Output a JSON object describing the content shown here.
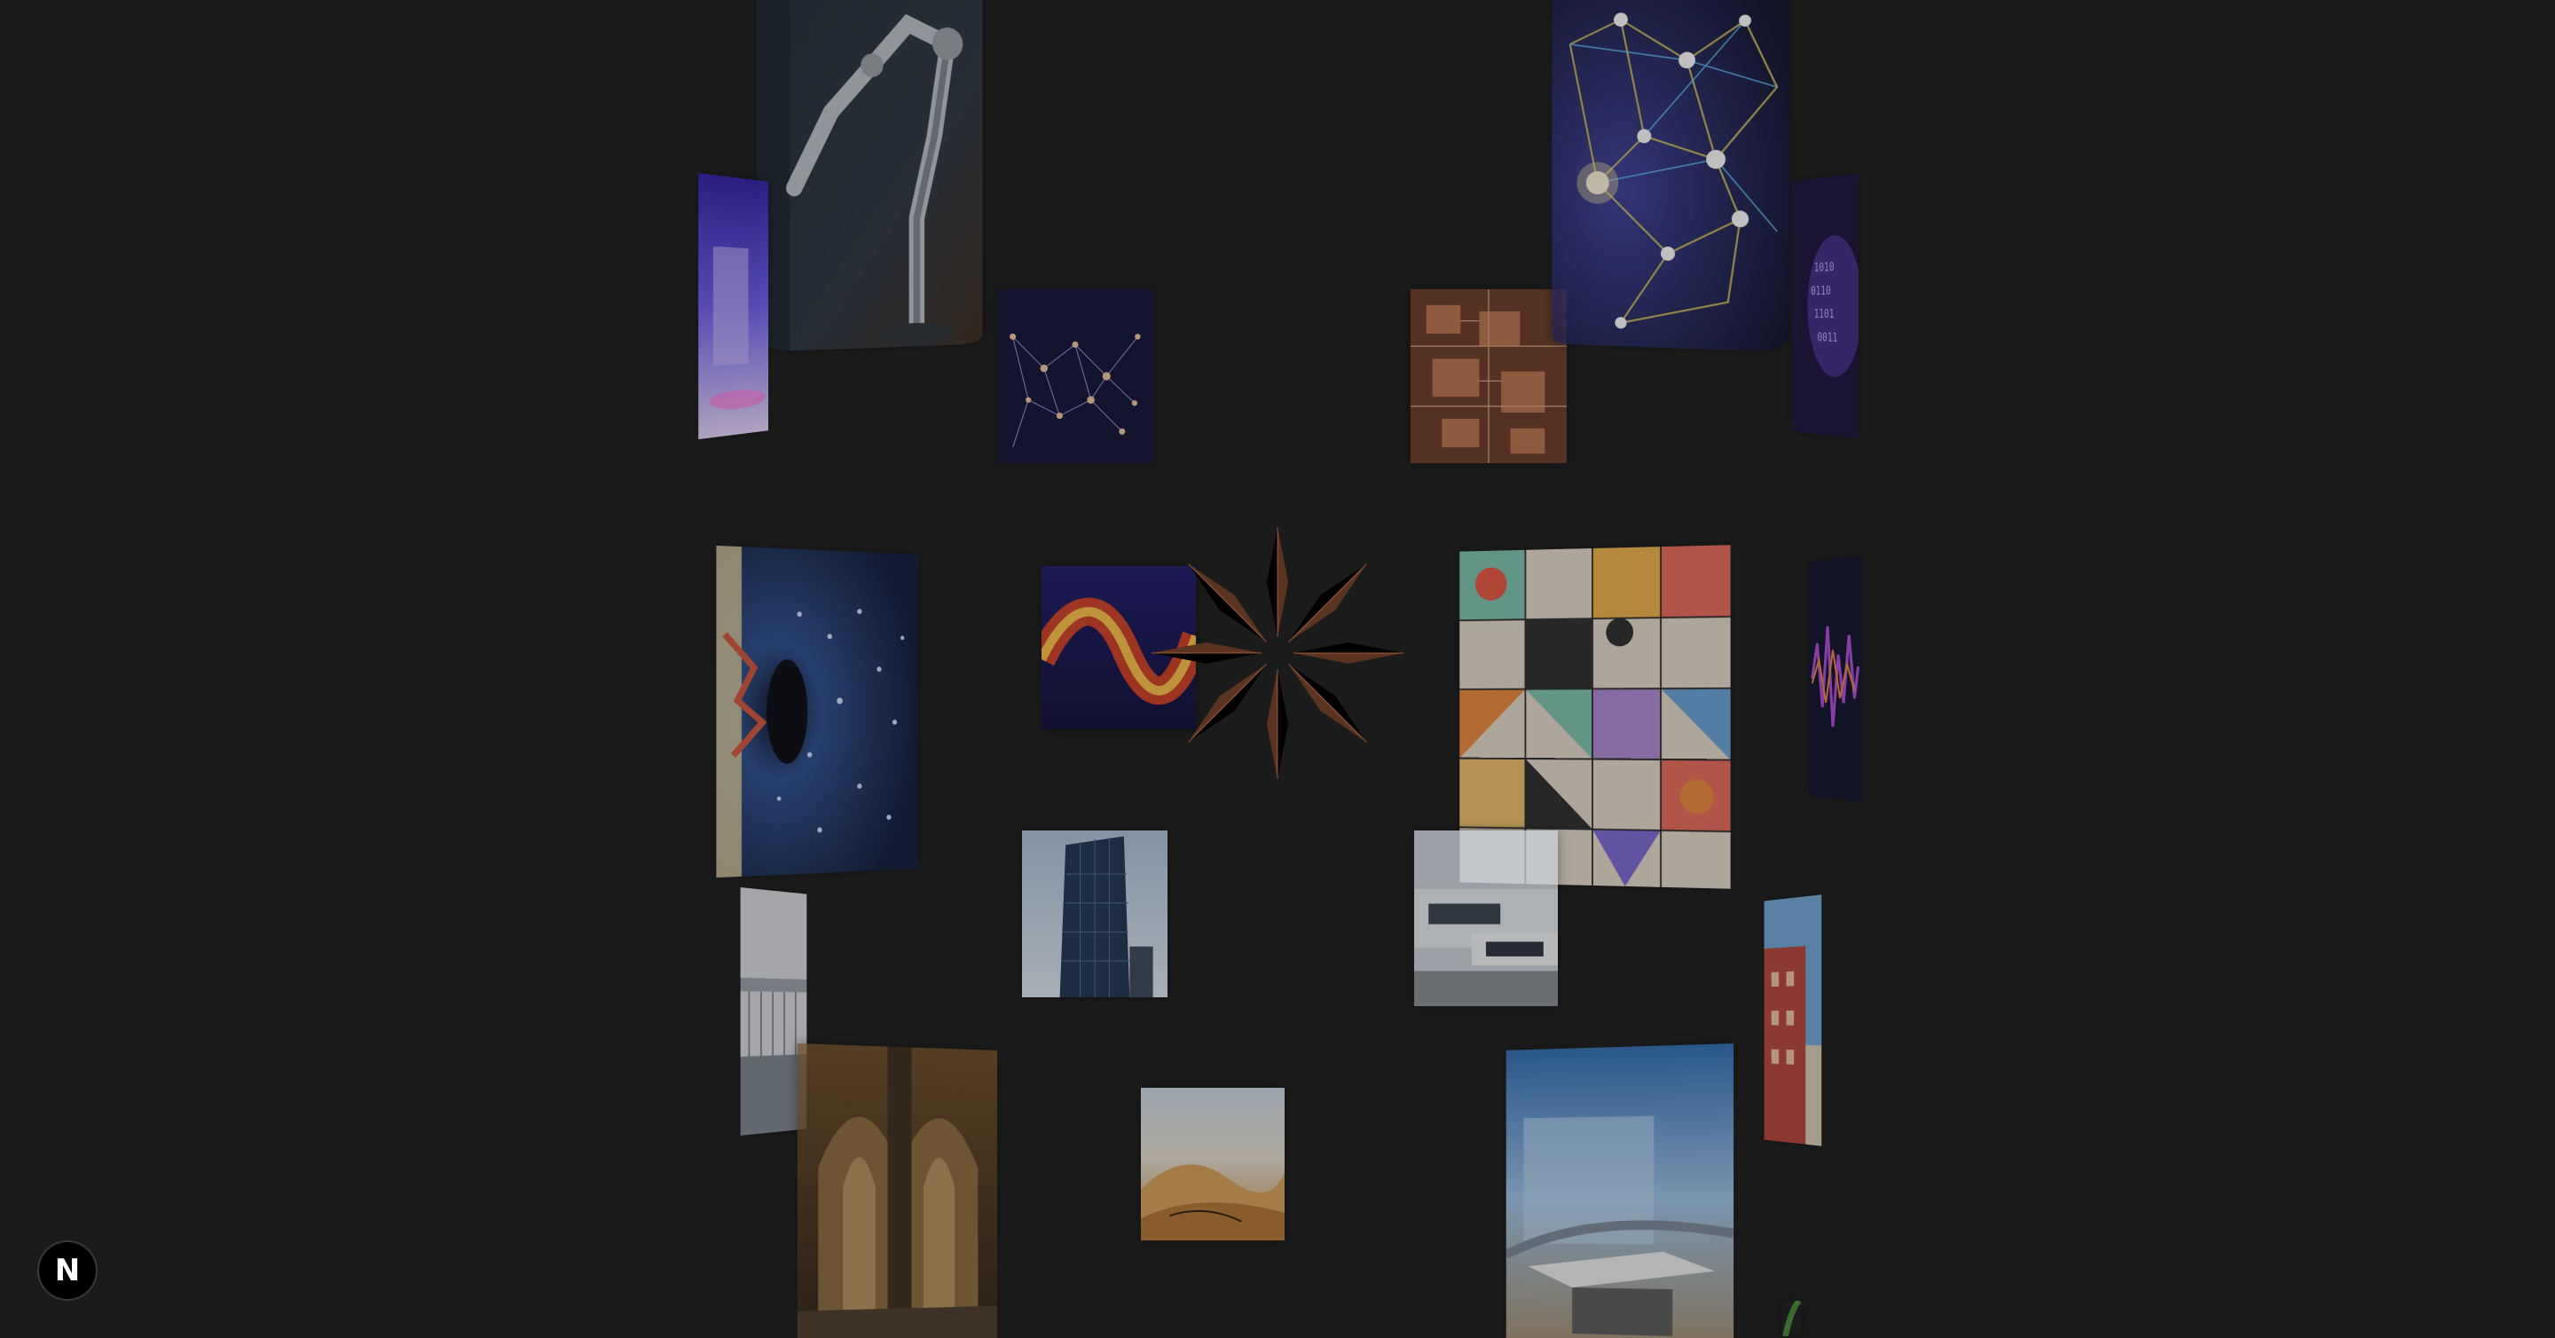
{
  "app": {
    "badge_label": "N"
  },
  "colors": {
    "background": "#1b1b1b",
    "badge_background": "#000000",
    "spinner_blade": "#000000",
    "spinner_edge": "#c8724a"
  },
  "gallery": {
    "tiles": [
      {
        "name": "robot-arm-image",
        "icon": "robotic-arm"
      },
      {
        "name": "purple-hologram-image",
        "icon": "hologram-room"
      },
      {
        "name": "network-graph-image",
        "icon": "node-network"
      },
      {
        "name": "circuit-board-image",
        "icon": "circuit-board"
      },
      {
        "name": "neural-network-image",
        "icon": "glowing-nodes"
      },
      {
        "name": "binary-sphere-image",
        "icon": "binary-sphere"
      },
      {
        "name": "data-eye-image",
        "icon": "particle-eye"
      },
      {
        "name": "fire-wave-image",
        "icon": "sine-wave"
      },
      {
        "name": "geometric-art-image",
        "icon": "geometric-pattern"
      },
      {
        "name": "audio-waveform-image",
        "icon": "waveform"
      },
      {
        "name": "glass-skyscraper-image",
        "icon": "skyscraper"
      },
      {
        "name": "modern-architecture-image",
        "icon": "modern-building"
      },
      {
        "name": "balcony-image",
        "icon": "balcony"
      },
      {
        "name": "cathedral-interior-image",
        "icon": "cathedral"
      },
      {
        "name": "desert-dunes-image",
        "icon": "dunes"
      },
      {
        "name": "glass-pavilion-image",
        "icon": "pavilion"
      },
      {
        "name": "red-building-image",
        "icon": "red-building"
      },
      {
        "name": "green-plant-image",
        "icon": "plant"
      }
    ]
  },
  "loader": {
    "icon": "compass-star-spinner",
    "blade_count": 8
  }
}
